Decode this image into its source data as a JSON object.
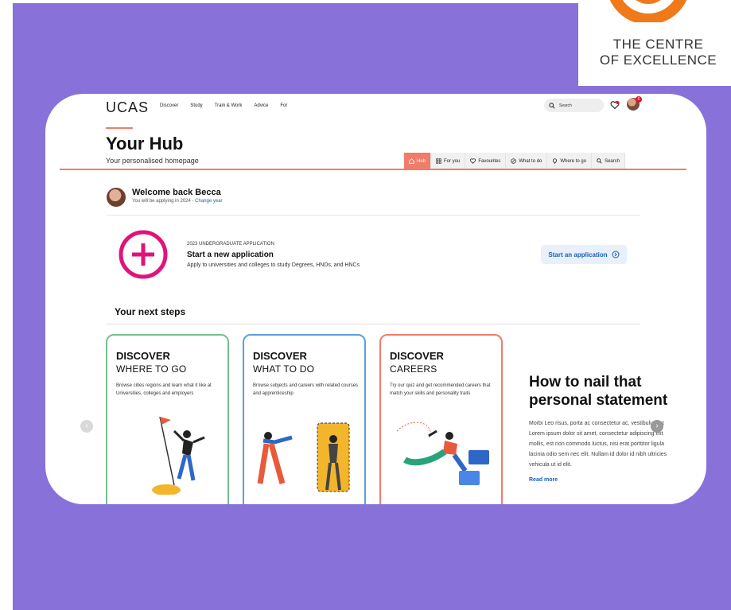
{
  "badge_logo": {
    "line1": "THE CENTRE",
    "line2": "OF EXCELLENCE"
  },
  "header": {
    "brand": "UCAS",
    "nav": [
      "Discover",
      "Study",
      "Train & Work",
      "Advice",
      "For"
    ],
    "search_label": "Search",
    "notifications_count": "0"
  },
  "hub": {
    "title": "Your Hub",
    "subtitle": "Your personalised homepage",
    "tabs": [
      {
        "label": "Hub",
        "icon": "home-icon",
        "active": true
      },
      {
        "label": "For you",
        "icon": "grid-icon",
        "active": false
      },
      {
        "label": "Favourites",
        "icon": "heart-icon",
        "active": false
      },
      {
        "label": "What to do",
        "icon": "compass-icon",
        "active": false
      },
      {
        "label": "Where to go",
        "icon": "location-icon",
        "active": false
      },
      {
        "label": "Search",
        "icon": "search-icon",
        "active": false
      }
    ]
  },
  "welcome": {
    "title": "Welcome back Becca",
    "subtitle": "You will be applying in 2024 - ",
    "change_link": "Change year"
  },
  "application": {
    "kicker": "2023 UNDERGRADUATE APPLICATION",
    "title": "Start a new application",
    "description": "Apply to universities and colleges to study Degrees, HNDs, and HNCs",
    "button": "Start an application"
  },
  "next_steps": {
    "title": "Your next steps",
    "cards": [
      {
        "h1": "DISCOVER",
        "h2": "WHERE TO GO",
        "desc": "Browse cities regions and learn what it like at Universities, colleges and employers",
        "color": "#74c08f"
      },
      {
        "h1": "DISCOVER",
        "h2": "WHAT TO DO",
        "desc": "Browse subjects and careers with related courses and apprenticeship",
        "color": "#5b9fe0"
      },
      {
        "h1": "DISCOVER",
        "h2": "CAREERS",
        "desc": "Try our quiz and get recommended careers that match your skills and personality traits",
        "color": "#f07d69"
      }
    ]
  },
  "article": {
    "title": "How to nail that personal statement",
    "body": "Morbi Leo risus, porta ac consectetur ac, vestibulum at\nLorem ipsum dolor sit amet, consectetur adipiscing elit\nmollis, est non commodo luctus, nisi erat porttitor ligula\nlacinia odio sem nec elit. Nullam id dolor id nibh ultricies\nvehicula ut id elit.",
    "read_more": "Read more"
  },
  "colors": {
    "background": "#8872d9",
    "accent": "#f07d69",
    "link": "#1d5fb5",
    "plus": "#e0137a"
  }
}
